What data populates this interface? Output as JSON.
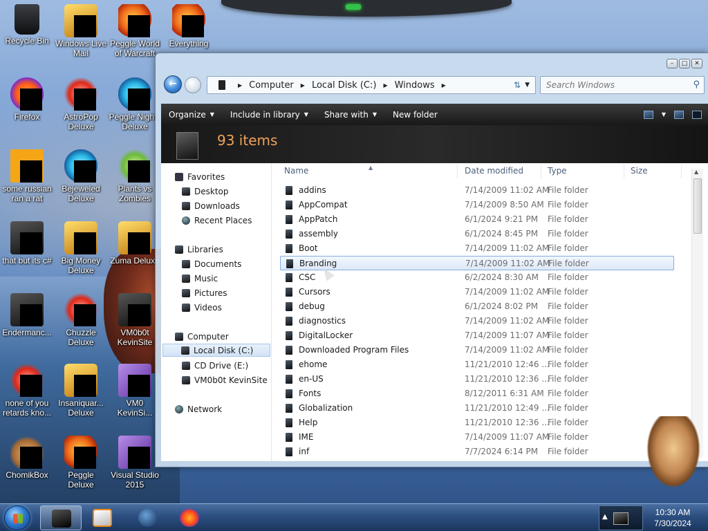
{
  "desktop": {
    "icons": [
      {
        "label": "Recycle Bin",
        "icon": "recycle-bin-icon"
      },
      {
        "label": "Windows Live Mail",
        "icon": "mail-icon"
      },
      {
        "label": "Peggle World of Warcraft",
        "icon": "peggle-icon"
      },
      {
        "label": "Everything",
        "icon": "search-app-icon"
      },
      {
        "label": "Firefox",
        "icon": "firefox-icon"
      },
      {
        "label": "AstroPop Deluxe",
        "icon": "game-icon"
      },
      {
        "label": "Peggle Nights Deluxe",
        "icon": "peggle-icon"
      },
      {
        "label": "some russian ran a rat",
        "icon": "app-icon"
      },
      {
        "label": "Bejeweled Deluxe",
        "icon": "gem-icon"
      },
      {
        "label": "Plants vs Zombies",
        "icon": "plant-icon"
      },
      {
        "label": "that but its c#",
        "icon": "app-icon"
      },
      {
        "label": "Big Money Deluxe",
        "icon": "money-bag-icon"
      },
      {
        "label": "Zuma Deluxe",
        "icon": "zuma-icon"
      },
      {
        "label": "Endermanc...",
        "icon": "app-icon"
      },
      {
        "label": "Chuzzle Deluxe",
        "icon": "chuzzle-icon"
      },
      {
        "label": "VM0b0t KevinSite",
        "icon": "app-icon"
      },
      {
        "label": "none of you retards kno...",
        "icon": "app-icon"
      },
      {
        "label": "Insaniquar... Deluxe",
        "icon": "fish-icon"
      },
      {
        "label": "VM0 KevinSi...",
        "icon": "app-icon"
      },
      {
        "label": "ChomikBox",
        "icon": "chomikbox-icon"
      },
      {
        "label": "Peggle Deluxe",
        "icon": "peggle-icon"
      },
      {
        "label": "Visual Studio 2015",
        "icon": "visual-studio-icon"
      }
    ]
  },
  "window": {
    "breadcrumb": [
      "Computer",
      "Local Disk (C:)",
      "Windows"
    ],
    "search_placeholder": "Search Windows",
    "toolbar": {
      "organize": "Organize",
      "include": "Include in library",
      "share": "Share with",
      "new_folder": "New folder"
    },
    "item_count": "93 items",
    "nav": {
      "favorites": "Favorites",
      "desktop": "Desktop",
      "downloads": "Downloads",
      "recent": "Recent Places",
      "libraries": "Libraries",
      "documents": "Documents",
      "music": "Music",
      "pictures": "Pictures",
      "videos": "Videos",
      "computer": "Computer",
      "local_disk": "Local Disk (C:)",
      "cd_drive": "CD Drive (E:)",
      "vm": "VM0b0t KevinSite",
      "network": "Network"
    },
    "columns": {
      "name": "Name",
      "date": "Date modified",
      "type": "Type",
      "size": "Size"
    },
    "files": [
      {
        "name": "addins",
        "date": "7/14/2009 11:02 AM",
        "type": "File folder"
      },
      {
        "name": "AppCompat",
        "date": "7/14/2009 8:50 AM",
        "type": "File folder"
      },
      {
        "name": "AppPatch",
        "date": "6/1/2024 9:21 PM",
        "type": "File folder"
      },
      {
        "name": "assembly",
        "date": "6/1/2024 8:45 PM",
        "type": "File folder"
      },
      {
        "name": "Boot",
        "date": "7/14/2009 11:02 AM",
        "type": "File folder"
      },
      {
        "name": "Branding",
        "date": "7/14/2009 11:02 AM",
        "type": "File folder"
      },
      {
        "name": "CSC",
        "date": "6/2/2024 8:30 AM",
        "type": "File folder"
      },
      {
        "name": "Cursors",
        "date": "7/14/2009 11:02 AM",
        "type": "File folder"
      },
      {
        "name": "debug",
        "date": "6/1/2024 8:02 PM",
        "type": "File folder"
      },
      {
        "name": "diagnostics",
        "date": "7/14/2009 11:02 AM",
        "type": "File folder"
      },
      {
        "name": "DigitalLocker",
        "date": "7/14/2009 11:07 AM",
        "type": "File folder"
      },
      {
        "name": "Downloaded Program Files",
        "date": "7/14/2009 11:02 AM",
        "type": "File folder"
      },
      {
        "name": "ehome",
        "date": "11/21/2010 12:46 ...",
        "type": "File folder"
      },
      {
        "name": "en-US",
        "date": "11/21/2010 12:36 ...",
        "type": "File folder"
      },
      {
        "name": "Fonts",
        "date": "8/12/2011 6:31 AM",
        "type": "File folder"
      },
      {
        "name": "Globalization",
        "date": "11/21/2010 12:49 ...",
        "type": "File folder"
      },
      {
        "name": "Help",
        "date": "11/21/2010 12:36 ...",
        "type": "File folder"
      },
      {
        "name": "IME",
        "date": "7/14/2009 11:07 AM",
        "type": "File folder"
      },
      {
        "name": "inf",
        "date": "7/7/2024 6:14 PM",
        "type": "File folder"
      }
    ],
    "selected_file": "Branding"
  },
  "taskbar": {
    "time": "10:30 AM",
    "date": "7/30/2024"
  },
  "colors": {
    "item_count": "#f0a25a",
    "toolbar_bg": "#1e1e1e",
    "selection_border": "#84acdd"
  }
}
